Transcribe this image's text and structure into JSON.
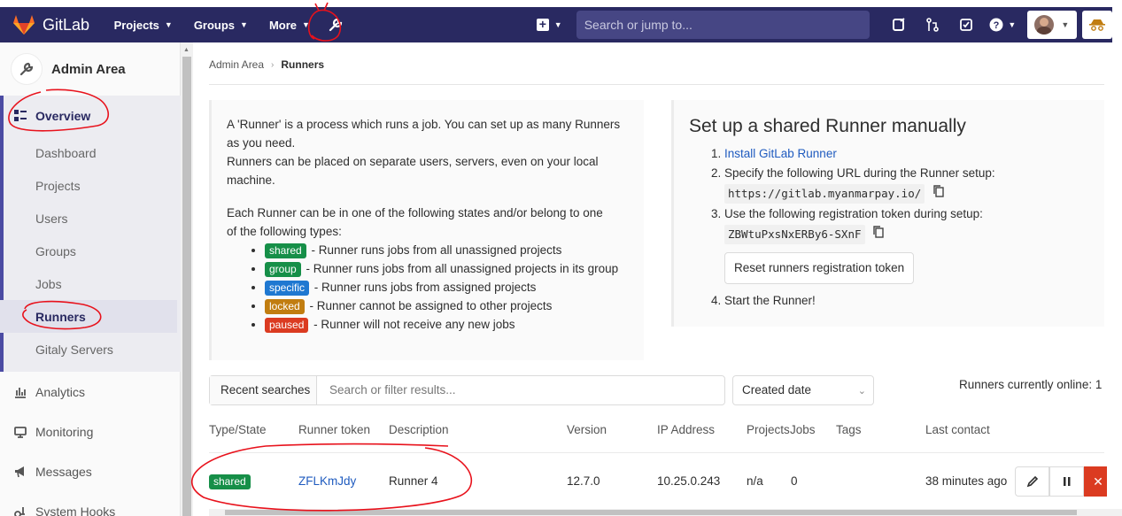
{
  "header": {
    "brand": "GitLab",
    "nav": [
      {
        "label": "Projects",
        "icon": "chevron-down-icon"
      },
      {
        "label": "Groups",
        "icon": "chevron-down-icon"
      },
      {
        "label": "More",
        "icon": "chevron-down-icon"
      }
    ],
    "search_placeholder": "Search or jump to...",
    "bg_color": "#292961"
  },
  "sidebar": {
    "context_title": "Admin Area",
    "overview_label": "Overview",
    "items": [
      "Dashboard",
      "Projects",
      "Users",
      "Groups",
      "Jobs",
      "Runners",
      "Gitaly Servers"
    ],
    "active_item": "Runners",
    "sections": [
      "Analytics",
      "Monitoring",
      "Messages",
      "System Hooks"
    ]
  },
  "breadcrumb": {
    "parent": "Admin Area",
    "current": "Runners"
  },
  "info": {
    "p1_line1": "A 'Runner' is a process which runs a job. You can set up as many Runners",
    "p1_line2": "as you need.",
    "p1_line3": "Runners can be placed on separate users, servers, even on your local",
    "p1_line4": "machine.",
    "p2_line1": "Each Runner can be in one of the following states and/or belong to one",
    "p2_line2": "of the following types:",
    "states": [
      {
        "badge": "shared",
        "text": "- Runner runs jobs from all unassigned projects",
        "color": "#168f48"
      },
      {
        "badge": "group",
        "text": "- Runner runs jobs from all unassigned projects in its group",
        "color": "#168f48"
      },
      {
        "badge": "specific",
        "text": "- Runner runs jobs from assigned projects",
        "color": "#1f78d1"
      },
      {
        "badge": "locked",
        "text": "- Runner cannot be assigned to other projects",
        "color": "#c17d10"
      },
      {
        "badge": "paused",
        "text": "- Runner will not receive any new jobs",
        "color": "#db3b21"
      }
    ]
  },
  "setup": {
    "title": "Set up a shared Runner manually",
    "step1_link": "Install GitLab Runner",
    "step2": "Specify the following URL during the Runner setup:",
    "url": "https://gitlab.myanmarpay.io/",
    "step3": "Use the following registration token during setup:",
    "token": "ZBWtuPxsNxERBy6-SXnF",
    "reset_button": "Reset runners registration token",
    "step4": "Start the Runner!"
  },
  "filter": {
    "recent_searches": "Recent searches",
    "placeholder": "Search or filter results...",
    "sort_label": "Created date",
    "online_text": "Runners currently online: 1"
  },
  "table": {
    "headers": [
      "Type/State",
      "Runner token",
      "Description",
      "Version",
      "IP Address",
      "Projects",
      "Jobs",
      "Tags",
      "Last contact"
    ],
    "rows": [
      {
        "type": "shared",
        "token": "ZFLKmJdy",
        "description": "Runner 4",
        "version": "12.7.0",
        "ip": "10.25.0.243",
        "projects": "n/a",
        "jobs": "0",
        "tags": "",
        "last_contact": "38 minutes ago"
      }
    ]
  }
}
